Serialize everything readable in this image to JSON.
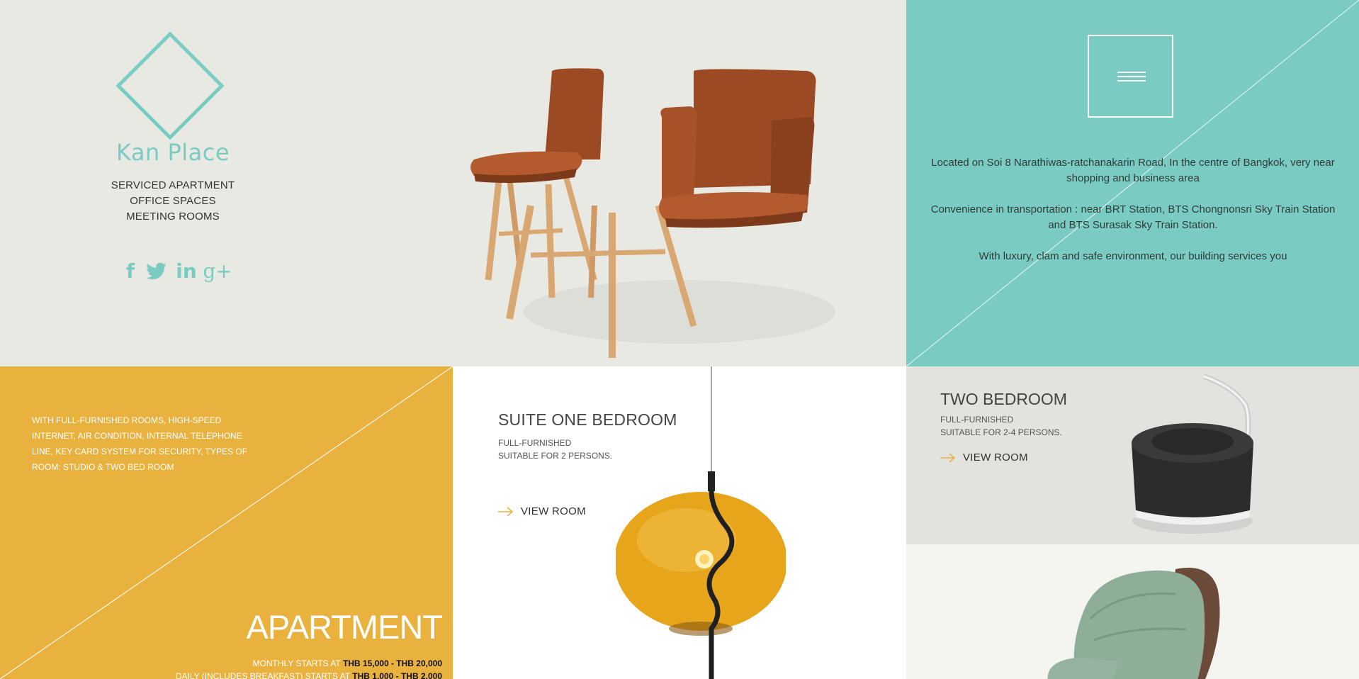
{
  "brand": {
    "name": "Kan Place",
    "services": [
      "SERVICED APARTMENT",
      "OFFICE SPACES",
      "MEETING ROOMS"
    ],
    "social": [
      {
        "name": "facebook",
        "label": "f"
      },
      {
        "name": "twitter",
        "label": ""
      },
      {
        "name": "linkedin",
        "label": "in"
      },
      {
        "name": "google-plus",
        "label": "g+"
      }
    ],
    "accent_color": "#7accc2"
  },
  "about": {
    "paragraphs": [
      "Located on Soi 8 Narathiwas-ratchanakarin Road, In the centre of Bangkok, very near shopping and business area",
      "Convenience in transportation : near BRT Station, BTS Chongnonsri Sky Train Station and BTS Surasak Sky Train Station.",
      "With luxury, clam and safe environment, our building services you"
    ],
    "menu_icon": "hamburger-icon"
  },
  "apartment": {
    "features": "WITH FULL-FURNISHED ROOMS, HIGH-SPEED INTERNET, AIR CONDITION, INTERNAL TELEPHONE LINE, KEY CARD SYSTEM FOR SECURITY, TYPES OF ROOM: STUDIO & TWO BED ROOM",
    "title": "APARTMENT",
    "monthly_label": "MONTHLY STARTS AT",
    "monthly_price": "THB 15,000 - THB 20,000",
    "daily_label": "DAILY (INCLUDES BREAKFAST) STARTS AT",
    "daily_price": "THB 1,000 - THB 2,000",
    "color": "#e9b13d"
  },
  "rooms": {
    "suite": {
      "title": "SUITE ONE BEDROOM",
      "line1": "FULL-FURNISHED",
      "line2": "SUITABLE FOR 2 PERSONS.",
      "link": "VIEW ROOM"
    },
    "two": {
      "title": "TWO BEDROOM",
      "line1": "FULL-FURNISHED",
      "line2": "SUITABLE FOR 2-4 PERSONS.",
      "link": "VIEW ROOM"
    },
    "arrow_color": "#e9b13d"
  }
}
